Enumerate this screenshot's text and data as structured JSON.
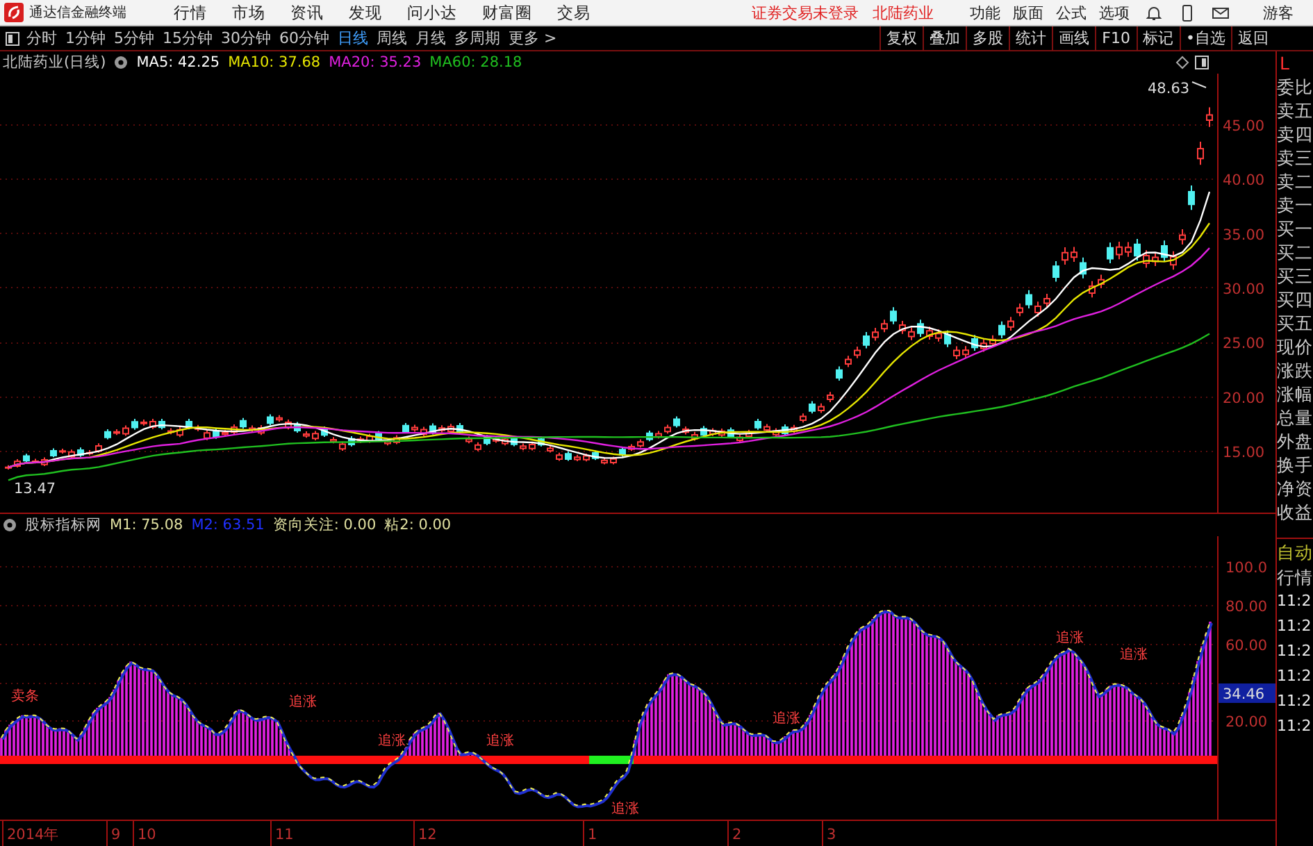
{
  "app": {
    "title": "通达信金融终端"
  },
  "menu": [
    "行情",
    "市场",
    "资讯",
    "发现",
    "问小达",
    "财富圈",
    "交易"
  ],
  "login_status": "证券交易未登录",
  "stock_link": "北陆药业",
  "tools": [
    "功能",
    "版面",
    "公式",
    "选项"
  ],
  "user": "游客",
  "periods": [
    {
      "label": "分时",
      "selected": false
    },
    {
      "label": "1分钟",
      "selected": false
    },
    {
      "label": "5分钟",
      "selected": false
    },
    {
      "label": "15分钟",
      "selected": false
    },
    {
      "label": "30分钟",
      "selected": false
    },
    {
      "label": "60分钟",
      "selected": false
    },
    {
      "label": "日线",
      "selected": true
    },
    {
      "label": "周线",
      "selected": false
    },
    {
      "label": "月线",
      "selected": false
    },
    {
      "label": "多周期",
      "selected": false
    },
    {
      "label": "更多 >",
      "selected": false
    }
  ],
  "actions": [
    "复权",
    "叠加",
    "多股",
    "统计",
    "画线",
    "F10",
    "标记",
    "•自选",
    "返回"
  ],
  "main_chart": {
    "title": "北陆药业(日线)",
    "ma": [
      {
        "label": "MA5: 42.25",
        "color": "#ffffff"
      },
      {
        "label": "MA10: 37.68",
        "color": "#e6e600"
      },
      {
        "label": "MA20: 35.23",
        "color": "#e020e0"
      },
      {
        "label": "MA60: 28.18",
        "color": "#20c020"
      }
    ],
    "y_labels": [
      "45.00",
      "40.00",
      "35.00",
      "30.00",
      "25.00",
      "20.00",
      "15.00"
    ],
    "high_label": "48.63",
    "low_label": "13.47"
  },
  "indicator": {
    "title": "股标指标网",
    "values": [
      {
        "label": "M1: 75.08",
        "color": "#e0e0a0"
      },
      {
        "label": "M2: 63.51",
        "color": "#2030ff"
      },
      {
        "label": "资向关注: 0.00",
        "color": "#e0e0a0"
      },
      {
        "label": "粘2: 0.00",
        "color": "#e0e0a0"
      }
    ],
    "y_labels": [
      "100.0",
      "80.00",
      "60.00",
      "20.00"
    ],
    "current_value": "34.46",
    "signals": [
      "卖条",
      "追涨",
      "追涨",
      "追涨",
      "追涨",
      "追涨",
      "追涨",
      "追涨"
    ]
  },
  "x_axis": [
    "2014年",
    "9",
    "10",
    "11",
    "12",
    "1",
    "2",
    "3"
  ],
  "side_panel": {
    "corner": "L",
    "labels": [
      "委比",
      "卖五",
      "卖四",
      "卖三",
      "卖二",
      "卖一",
      "买一",
      "买二",
      "买三",
      "买四",
      "买五",
      "现价",
      "涨跌",
      "涨幅",
      "总量",
      "外盘",
      "换手",
      "净资",
      "收益"
    ],
    "mode": "自动",
    "mode_2": "行情",
    "times": [
      "11:2",
      "11:2",
      "11:2",
      "11:2",
      "11:2",
      "11:2"
    ]
  }
}
